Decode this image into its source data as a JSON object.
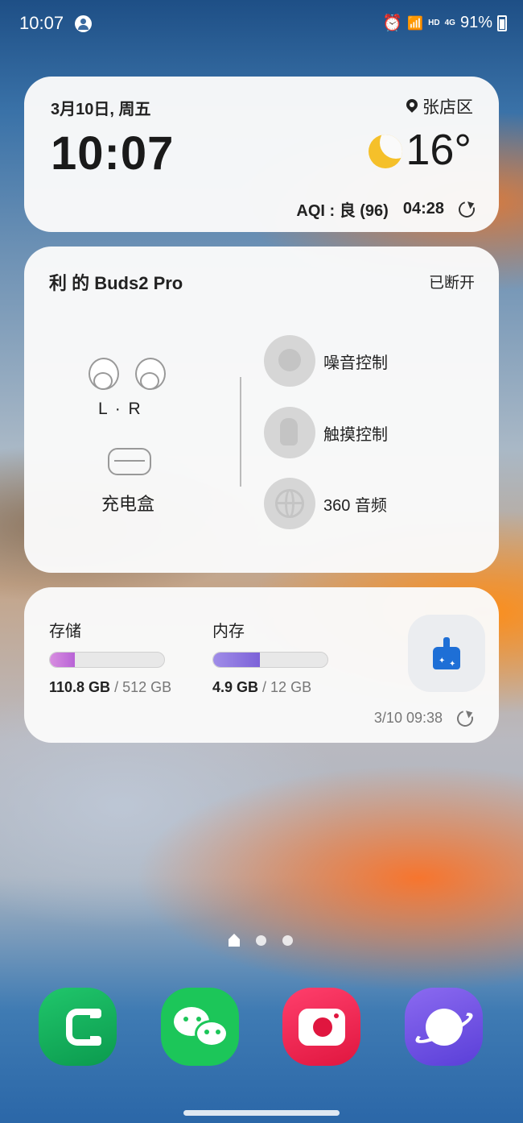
{
  "status_bar": {
    "time": "10:07",
    "network": "HD",
    "network_gen": "4G",
    "battery": "91%"
  },
  "clock_widget": {
    "date": "3月10日, 周五",
    "location": "张店区",
    "time": "10:07",
    "temperature": "16°",
    "aqi": "AQI : 良 (96)",
    "updated": "04:28",
    "weather_icon": "moon-icon"
  },
  "buds_widget": {
    "title": "利 的 Buds2 Pro",
    "status": "已断开",
    "earbuds_label": "L · R",
    "case_label": "充电盒",
    "features": [
      {
        "label": "噪音控制",
        "icon": "noise-control-icon"
      },
      {
        "label": "触摸控制",
        "icon": "touch-control-icon"
      },
      {
        "label": "360 音频",
        "icon": "audio-360-icon"
      }
    ]
  },
  "storage_widget": {
    "storage_title": "存储",
    "storage_used": "110.8 GB",
    "storage_total": "/ 512 GB",
    "storage_fraction": 0.216,
    "memory_title": "内存",
    "memory_used": "4.9 GB",
    "memory_total": "/ 12 GB",
    "memory_fraction": 0.408,
    "updated": "3/10 09:38",
    "clean_icon": "broom-clean-icon"
  },
  "dock": {
    "apps": [
      "phone-icon",
      "wechat-icon",
      "camera-icon",
      "internet-icon"
    ]
  },
  "colors": {
    "accent_blue": "#1e6fd6",
    "phone_green": "#0b9a4e",
    "wechat_green": "#1cc659",
    "camera_red": "#e0163f",
    "internet_purple": "#5a3fd8",
    "moon_yellow": "#f5c02a"
  }
}
